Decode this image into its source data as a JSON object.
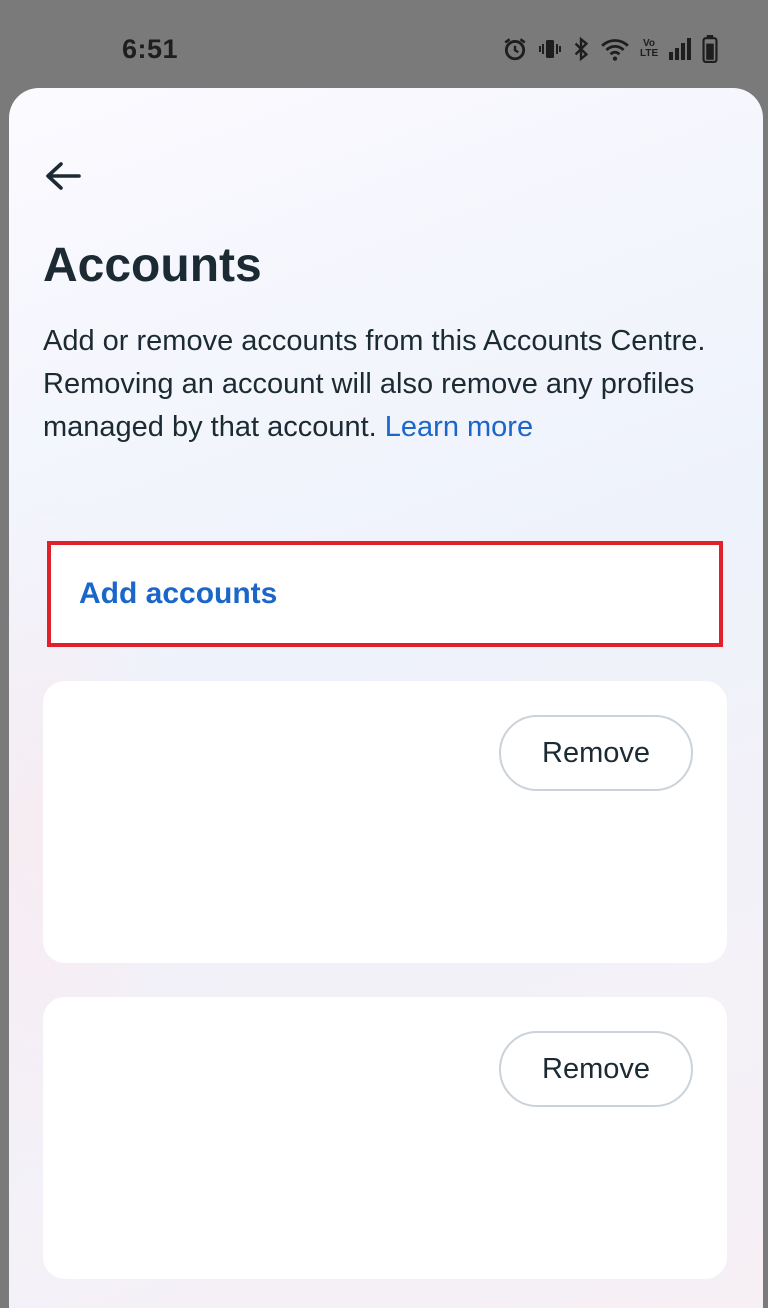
{
  "status_bar": {
    "time": "6:51",
    "icons": [
      "alarm-icon",
      "vibrate-icon",
      "bluetooth-icon",
      "wifi-icon",
      "volte-icon",
      "signal-icon",
      "battery-icon"
    ],
    "volte_label_top": "Vo",
    "volte_label_bottom": "LTE"
  },
  "header": {
    "back_icon": "arrow-left-icon",
    "title": "Accounts",
    "description": "Add or remove accounts from this Accounts Centre. Removing an account will also remove any profiles managed by that account.",
    "learn_more": "Learn more"
  },
  "add_accounts": {
    "label": "Add accounts",
    "highlight_color": "#e0202a"
  },
  "accounts": [
    {
      "remove_label": "Remove"
    },
    {
      "remove_label": "Remove"
    }
  ],
  "colors": {
    "link": "#1a66c9",
    "text": "#1c2b33"
  }
}
